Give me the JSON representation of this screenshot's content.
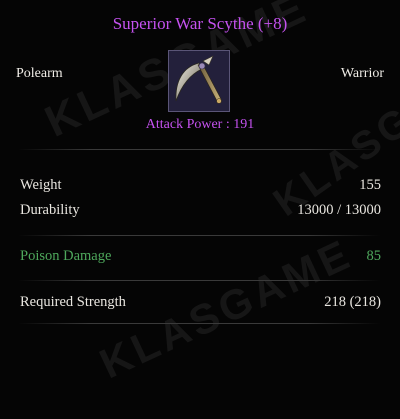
{
  "item": {
    "name": "Superior War Scythe (+8)",
    "category": "Polearm",
    "class": "Warrior",
    "icon": "war-scythe-icon",
    "attack_label": "Attack Power : ",
    "attack_value": "191"
  },
  "stats": [
    {
      "label": "Weight",
      "value": "155"
    },
    {
      "label": "Durability",
      "value": "13000 / 13000"
    }
  ],
  "bonus": {
    "label": "Poison Damage",
    "value": "85"
  },
  "requirements": [
    {
      "label": "Required Strength",
      "value": "218 (218)"
    }
  ],
  "watermark": "KLASGAME",
  "colors": {
    "title": "#c552f0",
    "bonus": "#4ea85c",
    "text": "#e9e6e0",
    "background": "#050505"
  }
}
